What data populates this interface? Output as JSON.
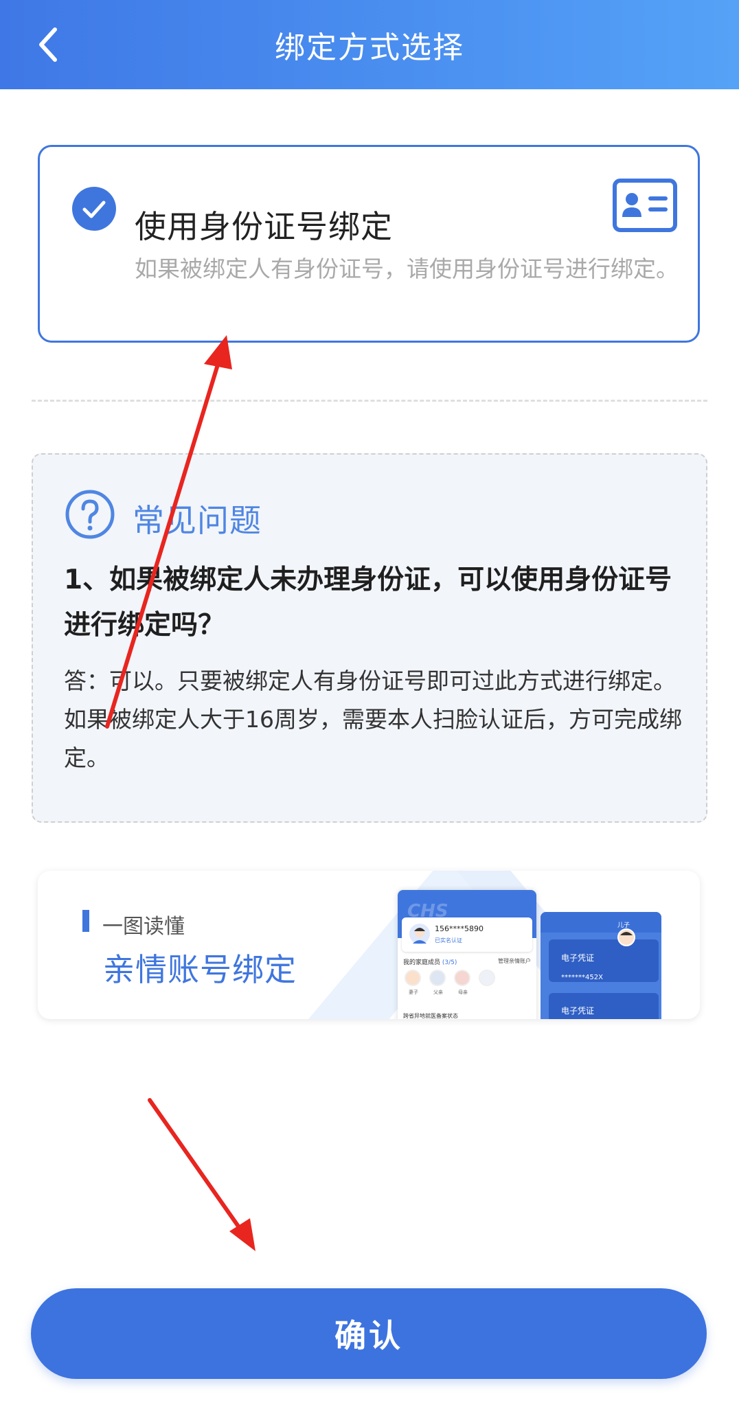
{
  "header": {
    "title": "绑定方式选择",
    "back_icon": "chevron-left-icon"
  },
  "option": {
    "title": "使用身份证号绑定",
    "description": "如果被绑定人有身份证号，请使用身份证号进行绑定。",
    "selected": true,
    "check_icon": "check-circle-icon",
    "card_icon": "id-card-icon"
  },
  "faq": {
    "icon": "question-circle-icon",
    "heading": "常见问题",
    "question": "1、如果被绑定人未办理身份证，可以使用身份证号进行绑定吗？",
    "answer": "答：可以。只要被绑定人有身份证号即可过此方式进行绑定。如果被绑定人大于16周岁，需要本人扫脸认证后，方可完成绑定。"
  },
  "banner": {
    "small_text": "一图读懂",
    "big_text": "亲情账号绑定",
    "mockup": {
      "logo": "CHS",
      "phone_number": "156****5890",
      "verified": "已实名认证",
      "members_label": "我的家庭成员",
      "members_count": "(3/5)",
      "manage_label": "管理亲情账户",
      "member_names": [
        "妻子",
        "父亲",
        "母亲"
      ],
      "remote_label": "跨省异地就医备案状态",
      "voucher_label": "电子凭证",
      "card_number": "*******452X",
      "avatar_label": "儿子"
    }
  },
  "actions": {
    "confirm_label": "确认"
  },
  "colors": {
    "primary": "#3f76de",
    "header_start": "#3f78e6",
    "header_end": "#55a2f7",
    "annotation_arrow": "#e8251f"
  }
}
